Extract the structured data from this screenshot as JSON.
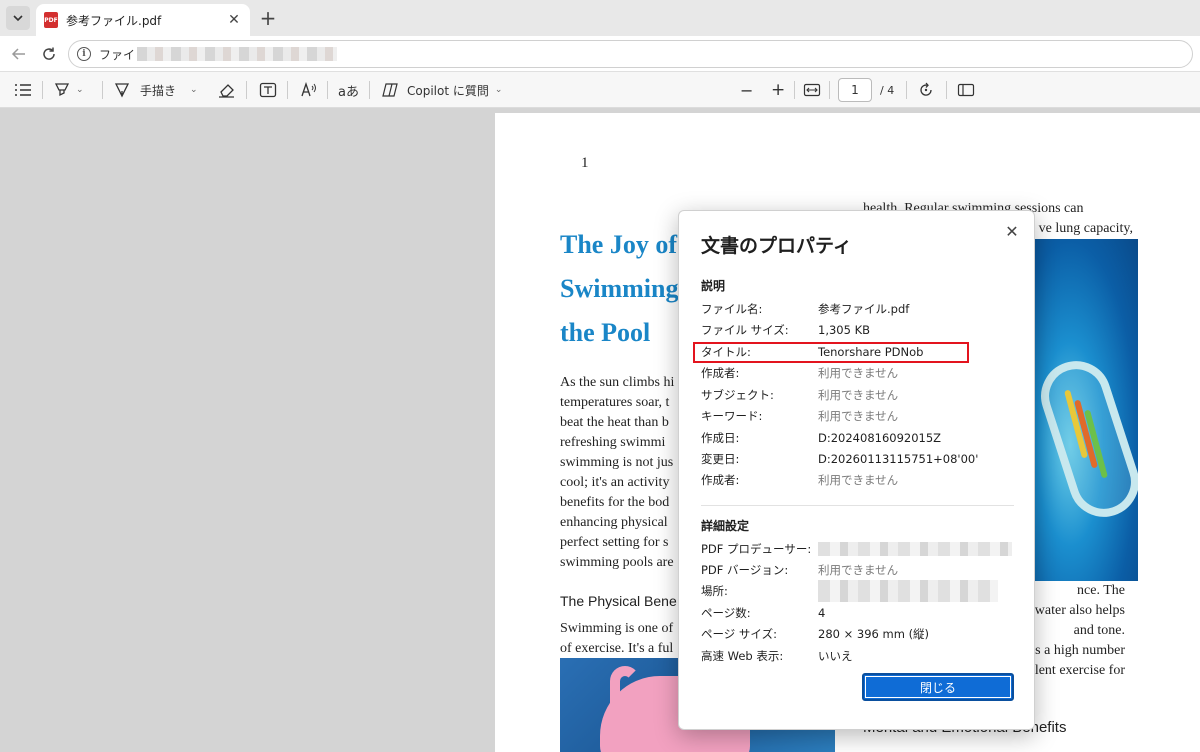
{
  "browser": {
    "tab_title": "参考ファイル.pdf",
    "url_prefix": "ファイ"
  },
  "pdf_toolbar": {
    "draw_label": "手描き",
    "copilot_label": "Copilot に質問",
    "current_page": "1",
    "total_pages": "/ 4"
  },
  "document": {
    "page_number": "1",
    "title": "The Joy of Swimming in the Pool",
    "title_lines": [
      "The Joy of",
      "Swimming",
      "the Pool"
    ],
    "body_left_lines": [
      "As the sun climbs hi",
      "temperatures soar, t",
      "beat the heat than b",
      "refreshing swimmi",
      "swimming is not jus",
      "cool; it's an activity",
      "benefits for the bod",
      "enhancing physical",
      "perfect setting for s",
      "swimming pools are"
    ],
    "section_heading": "The Physical Bene",
    "body_left2_lines": [
      "Swimming is one of",
      "of exercise. It's a ful"
    ],
    "right_top_lines": [
      "health. Regular swimming sessions can",
      "ve lung capacity,"
    ],
    "right_bottom_lines": [
      "nce. The",
      "water also helps",
      "and tone.",
      "as a high number",
      "llent exercise for"
    ],
    "mental_heading": "Mental and Emotional Benefits"
  },
  "dialog": {
    "title": "文書のプロパティ",
    "section_description": "説明",
    "section_advanced": "詳細設定",
    "close_button": "閉じる",
    "description_rows": [
      {
        "label": "ファイル名:",
        "value": "参考ファイル.pdf",
        "na": false
      },
      {
        "label": "ファイル サイズ:",
        "value": "1,305 KB",
        "na": false
      },
      {
        "label": "タイトル:",
        "value": "Tenorshare PDNob",
        "na": false
      },
      {
        "label": "作成者:",
        "value": "利用できません",
        "na": true
      },
      {
        "label": "サブジェクト:",
        "value": "利用できません",
        "na": true
      },
      {
        "label": "キーワード:",
        "value": "利用できません",
        "na": true
      },
      {
        "label": "作成日:",
        "value": "D:20240816092015Z",
        "na": false
      },
      {
        "label": "変更日:",
        "value": "D:20260113115751+08'00'",
        "na": false
      },
      {
        "label": "作成者:",
        "value": "利用できません",
        "na": true
      }
    ],
    "advanced_rows": [
      {
        "label": "PDF プロデューサー:",
        "value": "",
        "na": false
      },
      {
        "label": "PDF バージョン:",
        "value": "利用できません",
        "na": true
      },
      {
        "label": "場所:",
        "value": "",
        "na": false
      },
      {
        "label": "ページ数:",
        "value": "4",
        "na": false
      },
      {
        "label": "ページ サイズ:",
        "value": "280 × 396 mm (縦)",
        "na": false
      },
      {
        "label": "高速 Web 表示:",
        "value": "いいえ",
        "na": false
      }
    ]
  },
  "colors": {
    "accent": "#0f6cd6",
    "title_blue": "#1a86c7",
    "highlight_red": "#e3141e"
  }
}
